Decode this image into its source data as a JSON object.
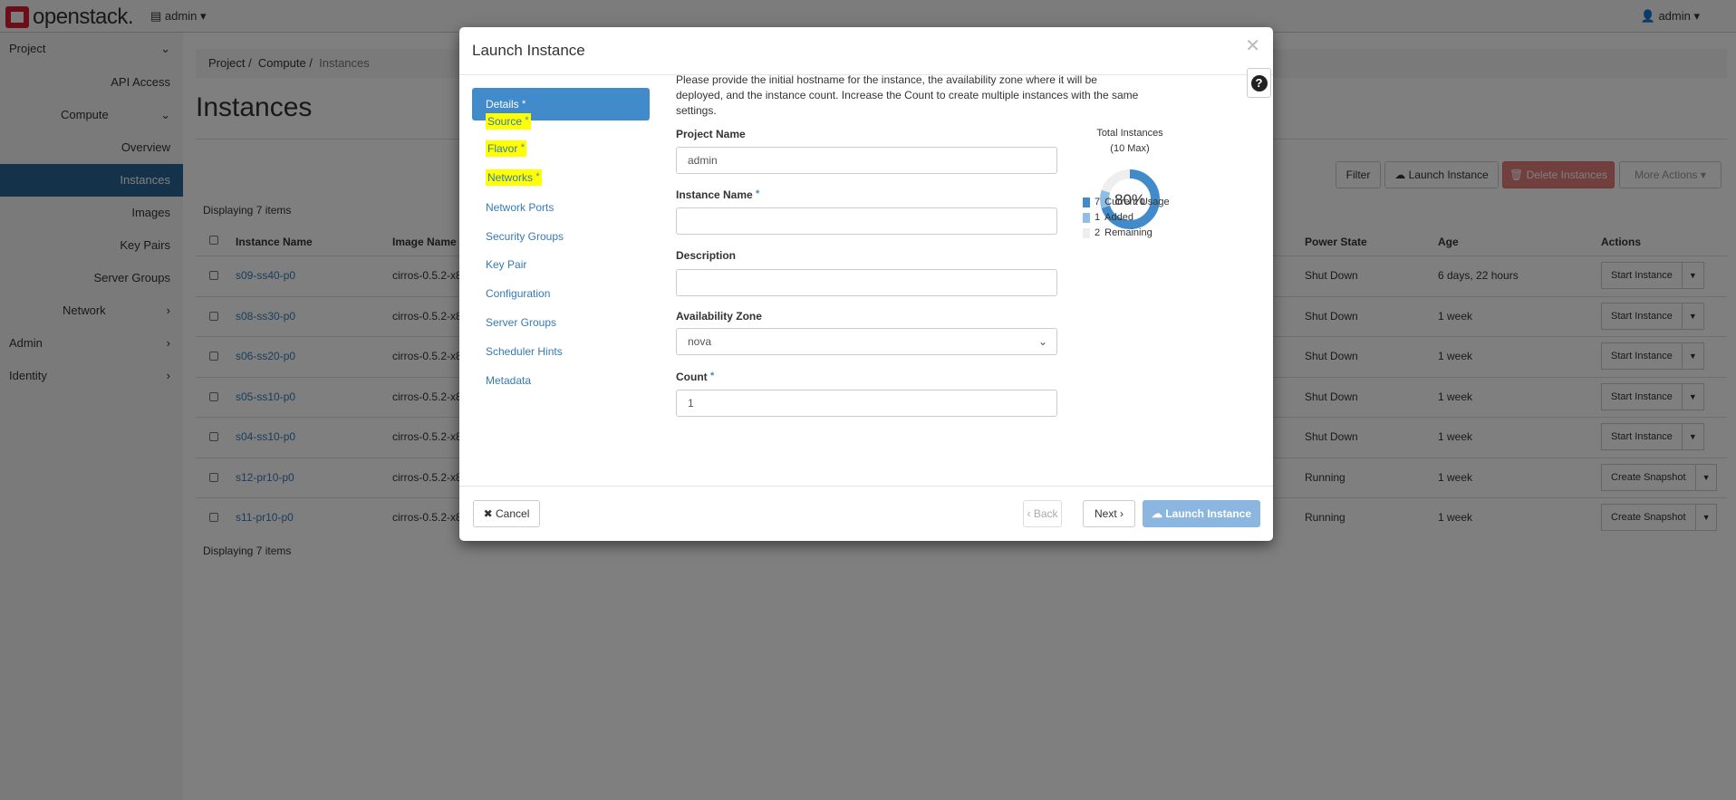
{
  "topnav": {
    "brand": "openstack.",
    "project": "admin",
    "user": "admin"
  },
  "sidebar": [
    {
      "label": "Project",
      "type": "section",
      "expanded": true
    },
    {
      "label": "API Access",
      "type": "item"
    },
    {
      "label": "Compute",
      "type": "group",
      "expanded": true
    },
    {
      "label": "Overview",
      "type": "item"
    },
    {
      "label": "Instances",
      "type": "item",
      "active": true
    },
    {
      "label": "Images",
      "type": "item"
    },
    {
      "label": "Key Pairs",
      "type": "item"
    },
    {
      "label": "Server Groups",
      "type": "item"
    },
    {
      "label": "Network",
      "type": "group"
    },
    {
      "label": "Admin",
      "type": "section"
    },
    {
      "label": "Identity",
      "type": "section"
    }
  ],
  "breadcrumb": [
    "Project",
    "Compute",
    "Instances"
  ],
  "page_title": "Instances",
  "toolbar": {
    "filter": "Filter",
    "launch": "Launch Instance",
    "delete": "Delete Instances",
    "more": "More Actions"
  },
  "displaying": "Displaying 7 items",
  "table": {
    "headers": [
      "Instance Name",
      "Image Name",
      "Power State",
      "Age",
      "Actions"
    ],
    "rows": [
      {
        "name": "s09-ss40-p0",
        "image": "cirros-0.5.2-x8",
        "power": "Shut Down",
        "age": "6 days, 22 hours",
        "action": "Start Instance"
      },
      {
        "name": "s08-ss30-p0",
        "image": "cirros-0.5.2-x8",
        "power": "Shut Down",
        "age": "1 week",
        "action": "Start Instance"
      },
      {
        "name": "s06-ss20-p0",
        "image": "cirros-0.5.2-x8",
        "power": "Shut Down",
        "age": "1 week",
        "action": "Start Instance"
      },
      {
        "name": "s05-ss10-p0",
        "image": "cirros-0.5.2-x8",
        "power": "Shut Down",
        "age": "1 week",
        "action": "Start Instance"
      },
      {
        "name": "s04-ss10-p0",
        "image": "cirros-0.5.2-x8",
        "power": "Shut Down",
        "age": "1 week",
        "action": "Start Instance"
      },
      {
        "name": "s12-pr10-p0",
        "image": "cirros-0.5.2-x8",
        "power": "Running",
        "age": "1 week",
        "action": "Create Snapshot"
      },
      {
        "name": "s11-pr10-p0",
        "image": "cirros-0.5.2-x8",
        "power": "Running",
        "age": "1 week",
        "action": "Create Snapshot"
      }
    ]
  },
  "modal": {
    "title": "Launch Instance",
    "nav": [
      {
        "label": "Details",
        "required": true,
        "active": true
      },
      {
        "label": "Source",
        "required": true,
        "highlighted": true
      },
      {
        "label": "Flavor",
        "required": true,
        "highlighted": true
      },
      {
        "label": "Networks",
        "required": true,
        "highlighted": true
      },
      {
        "label": "Network Ports"
      },
      {
        "label": "Security Groups"
      },
      {
        "label": "Key Pair"
      },
      {
        "label": "Configuration"
      },
      {
        "label": "Server Groups"
      },
      {
        "label": "Scheduler Hints"
      },
      {
        "label": "Metadata"
      }
    ],
    "description": "Please provide the initial hostname for the instance, the availability zone where it will be deployed, and the instance count. Increase the Count to create multiple instances with the same settings.",
    "fields": {
      "project_name": {
        "label": "Project Name",
        "value": "admin"
      },
      "instance_name": {
        "label": "Instance Name",
        "value": ""
      },
      "description": {
        "label": "Description",
        "value": ""
      },
      "availability_zone": {
        "label": "Availability Zone",
        "value": "nova"
      },
      "count": {
        "label": "Count",
        "value": "1"
      }
    },
    "required_mark": "*",
    "chart": {
      "title": "Total Instances",
      "subtitle": "(10 Max)",
      "percent_label": "80%",
      "legend": [
        {
          "value": "7",
          "label": "Current Usage",
          "color": "#428bca"
        },
        {
          "value": "1",
          "label": "Added",
          "color": "#8fbde6"
        },
        {
          "value": "2",
          "label": "Remaining",
          "color": "#eeeeee"
        }
      ]
    },
    "buttons": {
      "cancel": "Cancel",
      "back": "‹ Back",
      "next": "Next ›",
      "launch": "Launch Instance"
    }
  },
  "chart_data": {
    "type": "pie",
    "title": "Total Instances",
    "subtitle": "(10 Max)",
    "categories": [
      "Current Usage",
      "Added",
      "Remaining"
    ],
    "values": [
      7,
      1,
      2
    ],
    "center_label": "80%"
  }
}
